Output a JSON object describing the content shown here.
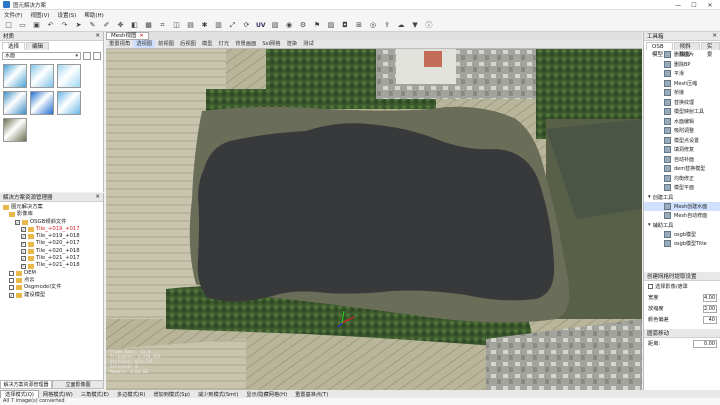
{
  "window": {
    "title": "图元解决方案",
    "min_label": "—",
    "max_label": "☐",
    "close_label": "✕"
  },
  "menu": [
    "文件(F)",
    "视图(V)",
    "设置(S)",
    "帮助(H)"
  ],
  "toolbar": {
    "uv_label": "UV"
  },
  "left_top": {
    "header": "材质",
    "tabs": [
      "选择",
      "编辑"
    ],
    "material_select": "水面",
    "textures": [
      {
        "color": "#4aa3d6"
      },
      {
        "color": "#7fc4e8"
      },
      {
        "color": "#9fd7f0"
      },
      {
        "color": "#3f8dc5"
      },
      {
        "color": "#1f6fd0"
      },
      {
        "color": "#6ab7e6"
      },
      {
        "color": "#6b6e4e"
      }
    ]
  },
  "left_bottom": {
    "header": "解决方案资源管理器",
    "tree": [
      {
        "indent": 0,
        "label": "图元解决方案",
        "checked": null,
        "red": false
      },
      {
        "indent": 1,
        "label": "影像库",
        "checked": null,
        "red": false
      },
      {
        "indent": 2,
        "label": "OSGB倾斜文件",
        "checked": true,
        "red": false
      },
      {
        "indent": 3,
        "label": "Tile_+019_+017",
        "checked": true,
        "red": true
      },
      {
        "indent": 3,
        "label": "Tile_+019_+018",
        "checked": true,
        "red": false
      },
      {
        "indent": 3,
        "label": "Tile_+020_+017",
        "checked": true,
        "red": false
      },
      {
        "indent": 3,
        "label": "Tile_+020_+018",
        "checked": true,
        "red": false
      },
      {
        "indent": 3,
        "label": "Tile_+021_+017",
        "checked": true,
        "red": false
      },
      {
        "indent": 3,
        "label": "Tile_+021_+018",
        "checked": true,
        "red": false
      },
      {
        "indent": 1,
        "label": "DEM",
        "checked": false,
        "red": false
      },
      {
        "indent": 1,
        "label": "点云",
        "checked": false,
        "red": false
      },
      {
        "indent": 1,
        "label": "Osgmodel文件",
        "checked": false,
        "red": false
      },
      {
        "indent": 1,
        "label": "建设模型",
        "checked": true,
        "red": false
      }
    ],
    "bottom_tabs": [
      "解决方案资源管理器",
      "立面影像图"
    ]
  },
  "center": {
    "doc_tab": "Mesh视图",
    "doc_close": "✕",
    "view_tabs": [
      "重置视角",
      "透视图",
      "前视图",
      "后视图",
      "模型",
      "灯光",
      "背景画面",
      "Ssl网格",
      "渲染",
      "测试"
    ],
    "active_view_tab": 1,
    "overlay_lines": [
      "Frame Rate: 61.0",
      "Triangles: 1,258,352",
      "Vertices: 874,251",
      "Selected: 0",
      "Memory: 1.64 GB"
    ]
  },
  "right": {
    "header": "工具箱",
    "tabs": [
      "OSB模型",
      "倾斜摄影",
      "实景"
    ],
    "tools": [
      "删除面片",
      "删除BP",
      "平滑",
      "Mesh压缩",
      "桥接",
      "替换纹理",
      "模型映射工具",
      "水面编辑",
      "吸附调整",
      "模型点设置",
      "填洞修复",
      "自动补面",
      "dem替换模型",
      "均衡修正",
      "模型平面"
    ],
    "section1": "创建工具",
    "section1_items": [
      "Mesh创建水面",
      "Mesh自动修面"
    ],
    "section1_highlight": 0,
    "section2": "辅助工具",
    "section2_items": [
      "osgb模型",
      "osgb模型Title"
    ],
    "props_header": "创建网格时提取设置",
    "props_checkbox": "选择影像/遮罩",
    "props": [
      {
        "label": "宽度",
        "value": "4.00"
      },
      {
        "label": "放缩度",
        "value": "2.00"
      },
      {
        "label": "颜色偏差",
        "value": "40"
      }
    ],
    "bottom_header": "圆弧移动",
    "bottom_row": {
      "label": "距离:",
      "value": "0.00"
    }
  },
  "statusbar": [
    "选择模式(Q)",
    "网格模式(W)",
    "三角模式(E)",
    "多边模式(R)",
    "增加到模式(Sp)",
    "减少到模式(Smt)",
    "显示/隐藏网格(H)",
    "重置基准点(T)"
  ],
  "statusbar_active": 0,
  "footer": "All 7 image(s) converted"
}
